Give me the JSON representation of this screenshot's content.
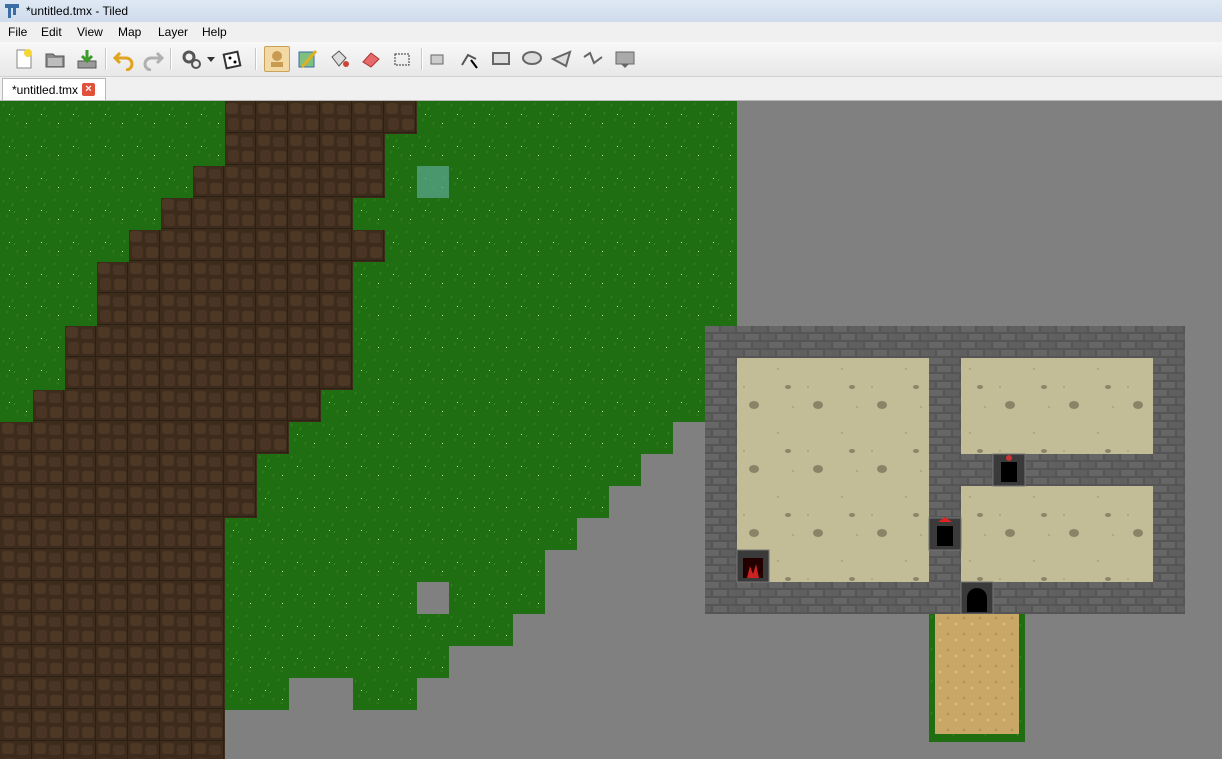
{
  "window": {
    "title": "*untitled.tmx - Tiled",
    "app_icon": "tiled-icon"
  },
  "menu": [
    "File",
    "Edit",
    "View",
    "Map",
    "Layer",
    "Help"
  ],
  "toolbar": {
    "buttons": [
      {
        "name": "new-map-icon"
      },
      {
        "name": "open-file-icon"
      },
      {
        "name": "save-icon"
      },
      {
        "name": "undo-icon"
      },
      {
        "name": "redo-icon"
      },
      {
        "name": "command-gears-icon"
      },
      {
        "name": "dropdown-arrow-icon"
      },
      {
        "name": "random-mode-dice-icon"
      },
      {
        "name": "stamp-brush-icon",
        "active": true
      },
      {
        "name": "terrain-brush-icon"
      },
      {
        "name": "bucket-fill-icon"
      },
      {
        "name": "eraser-icon"
      },
      {
        "name": "rectangular-select-icon"
      },
      {
        "name": "select-objects-icon"
      },
      {
        "name": "edit-polygons-icon"
      },
      {
        "name": "insert-rectangle-icon"
      },
      {
        "name": "insert-ellipse-icon"
      },
      {
        "name": "insert-polygon-icon"
      },
      {
        "name": "insert-polyline-icon"
      },
      {
        "name": "insert-tile-icon"
      }
    ]
  },
  "tabs": [
    {
      "label": "*untitled.tmx",
      "close_icon": "close-tab-icon"
    }
  ],
  "map": {
    "tile_size": 32,
    "colors": {
      "grass": "#1f6e12",
      "dirt": "#3d2b1c",
      "stone": "#4e4e4e",
      "sand": "#c2bd97",
      "path": "#c9a867",
      "background": "#808080"
    }
  }
}
